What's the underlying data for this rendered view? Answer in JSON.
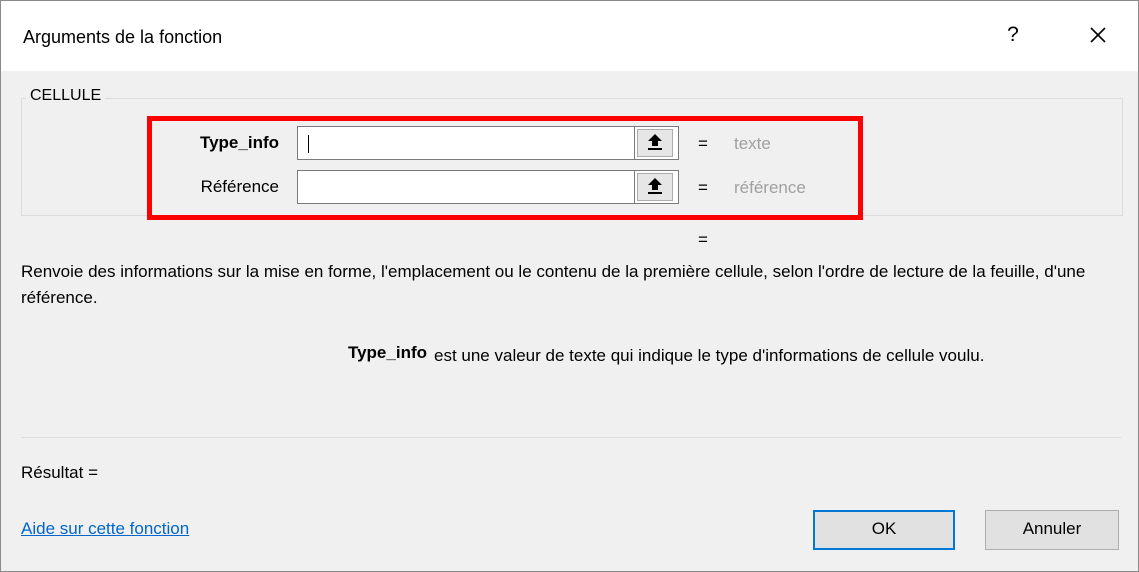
{
  "window": {
    "title": "Arguments de la fonction",
    "help_glyph": "?",
    "close_icon": "close-icon"
  },
  "function_group": {
    "name": "CELLULE",
    "arguments": [
      {
        "label": "Type_info",
        "value": "",
        "equals": "=",
        "hint": "texte"
      },
      {
        "label": "Référence",
        "value": "",
        "equals": "=",
        "hint": "référence"
      }
    ],
    "overall_equals": "="
  },
  "description": "Renvoie des informations sur la mise en forme, l'emplacement ou le contenu de la première cellule, selon l'ordre de lecture de la feuille, d'une référence.",
  "argument_help": {
    "name": "Type_info",
    "text": "est une valeur de texte qui indique le type d'informations de cellule voulu."
  },
  "result_label": "Résultat =",
  "help_link": "Aide sur cette fonction",
  "buttons": {
    "ok": "OK",
    "cancel": "Annuler"
  },
  "colors": {
    "highlight": "#ff0000",
    "link": "#0066cc",
    "default_button_border": "#0078d7"
  }
}
